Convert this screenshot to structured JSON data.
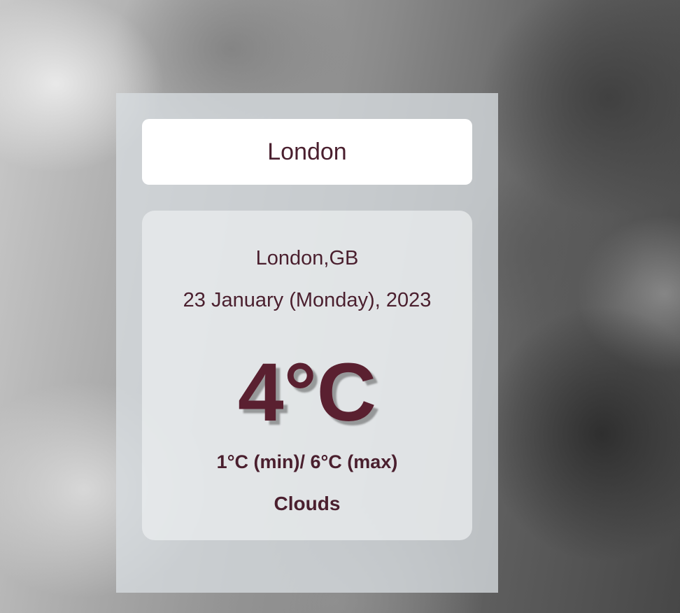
{
  "search": {
    "value": "London"
  },
  "weather": {
    "location": "London,GB",
    "date": "23 January (Monday), 2023",
    "temperature": "4°C",
    "min_max": "1°C (min)/ 6°C (max)",
    "condition": "Clouds"
  },
  "colors": {
    "text": "#4a1f2e",
    "temperature": "#5a2030",
    "search_bg": "#ffffff"
  }
}
